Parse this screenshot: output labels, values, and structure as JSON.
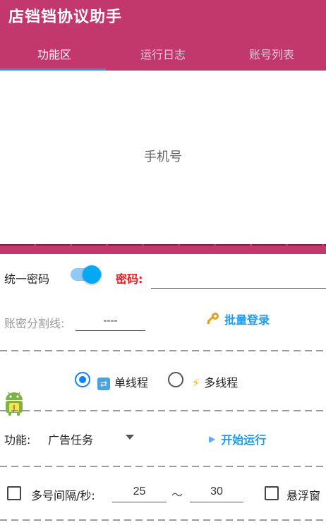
{
  "app": {
    "title": "店铛铛协议助手"
  },
  "tabs": [
    {
      "label": "功能区",
      "active": true
    },
    {
      "label": "运行日志",
      "active": false
    },
    {
      "label": "账号列表",
      "active": false
    }
  ],
  "phone": {
    "hint": "手机号"
  },
  "password_row": {
    "unified_label": "统一密码",
    "toggle_on": true,
    "password_label": "密码:",
    "password_value": ""
  },
  "separator_row": {
    "label": "账密分割线:",
    "value": "----",
    "batch_login_label": "批量登录",
    "batch_login_icon": "key-icon"
  },
  "thread_mode": {
    "single_label": "单线程",
    "multi_label": "多线程",
    "selected": "single"
  },
  "function_row": {
    "label": "功能:",
    "selected": "广告任务",
    "start_label": "开始运行"
  },
  "interval_row": {
    "label": "多号间隔/秒:",
    "min": "25",
    "tilde": "～",
    "max": "30",
    "float_label": "悬浮窗"
  },
  "colors": {
    "appbar": "#c2376c",
    "accent": "#1e9bf0",
    "danger": "#e8191e"
  }
}
